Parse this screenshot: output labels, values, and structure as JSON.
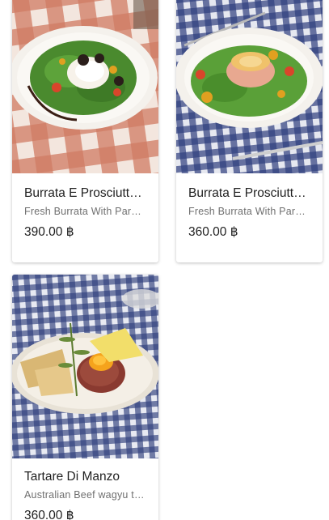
{
  "colors": {
    "card_background": "#ffffff",
    "title_text": "#1f1f1f",
    "description_text": "#6f6f6f",
    "price_text": "#1f1f1f",
    "red_gingham": "#c8553f",
    "blue_gingham": "#2f3f7d"
  },
  "menu": {
    "items": [
      {
        "title": "Burrata E Prosciutto...",
        "description": "Fresh Burrata With Parm...",
        "price": "390.00 ฿",
        "image": "burrata-salad-photo-red-tablecloth"
      },
      {
        "title": "Burrata E Prosciutto...",
        "description": "Fresh Burrata With Parm...",
        "price": "360.00 ฿",
        "image": "burrata-salad-photo-blue-tablecloth"
      },
      {
        "title": "Tartare Di Manzo",
        "description": "Australian Beef wagyu te...",
        "price": "360.00 ฿",
        "image": "beef-tartare-photo-blue-tablecloth"
      }
    ]
  }
}
